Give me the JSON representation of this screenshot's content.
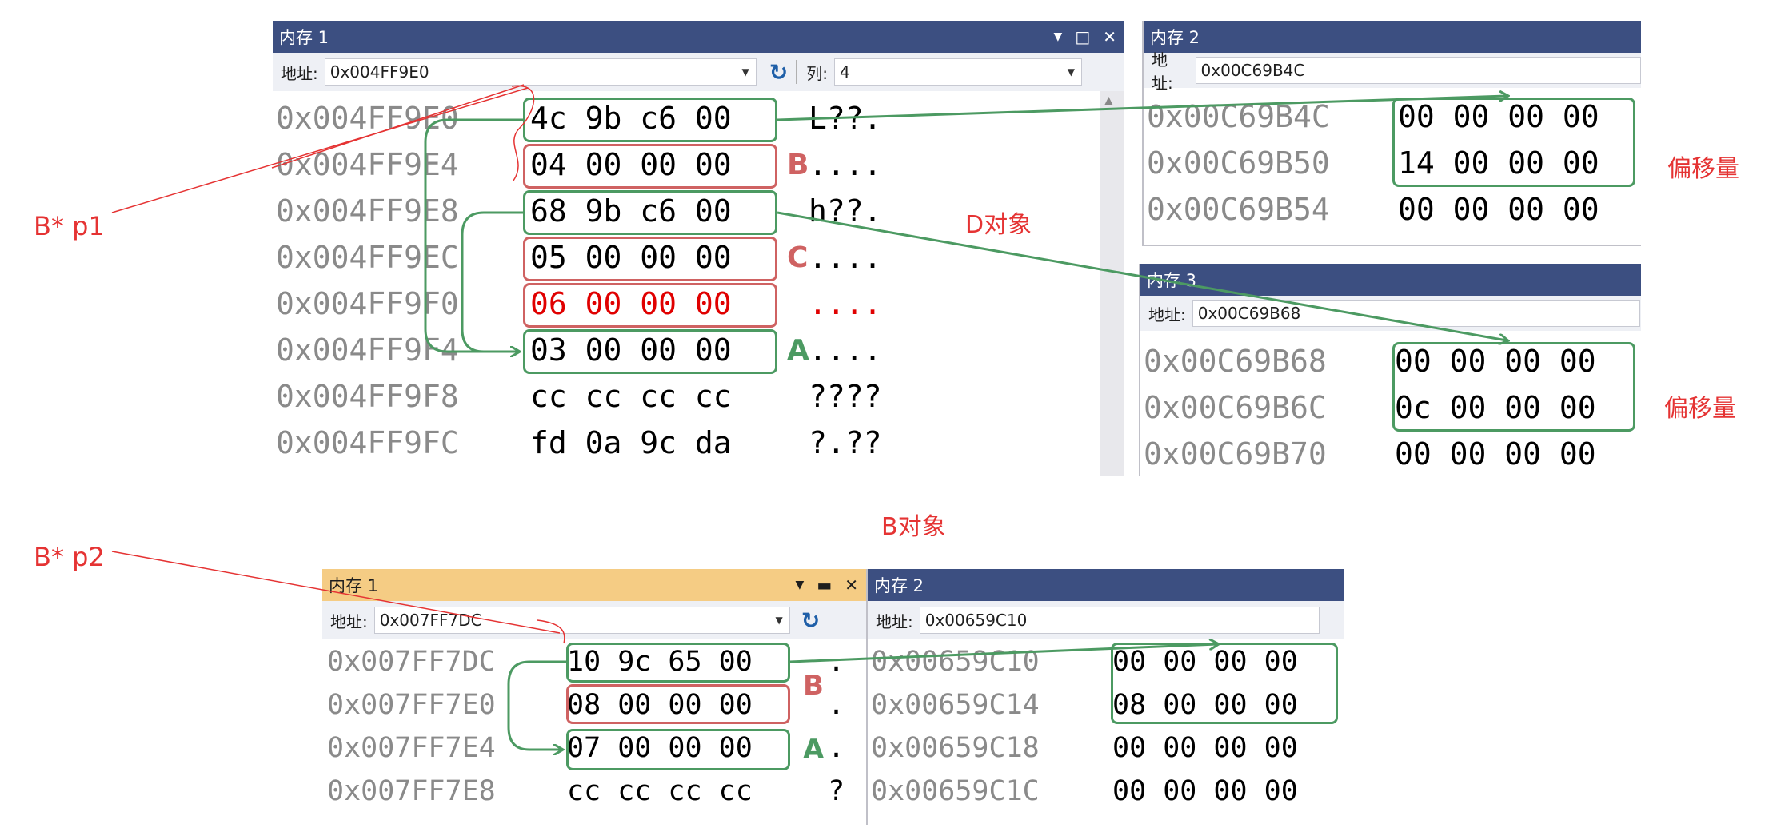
{
  "top": {
    "mem1": {
      "title": "内存 1",
      "addr_label": "地址:",
      "addr_value": "0x004FF9E0",
      "col_label": "列:",
      "col_value": "4",
      "rows": [
        {
          "addr": "0x004FF9E0",
          "bytes": "4c 9b c6 00",
          "ascii": "L??."
        },
        {
          "addr": "0x004FF9E4",
          "bytes": "04 00 00 00",
          "ascii": "...."
        },
        {
          "addr": "0x004FF9E8",
          "bytes": "68 9b c6 00",
          "ascii": "h??."
        },
        {
          "addr": "0x004FF9EC",
          "bytes": "05 00 00 00",
          "ascii": "...."
        },
        {
          "addr": "0x004FF9F0",
          "bytes": "06 00 00 00",
          "ascii": "...."
        },
        {
          "addr": "0x004FF9F4",
          "bytes": "03 00 00 00",
          "ascii": "...."
        },
        {
          "addr": "0x004FF9F8",
          "bytes": "cc cc cc cc",
          "ascii": "????"
        },
        {
          "addr": "0x004FF9FC",
          "bytes": "fd 0a 9c da",
          "ascii": "?.??"
        }
      ]
    },
    "mem2": {
      "title": "内存 2",
      "addr_label": "地址:",
      "addr_value": "0x00C69B4C",
      "rows": [
        {
          "addr": "0x00C69B4C",
          "bytes": "00 00 00 00"
        },
        {
          "addr": "0x00C69B50",
          "bytes": "14 00 00 00"
        },
        {
          "addr": "0x00C69B54",
          "bytes": "00 00 00 00"
        }
      ]
    },
    "mem3": {
      "title": "内存 3",
      "addr_label": "地址:",
      "addr_value": "0x00C69B68",
      "rows": [
        {
          "addr": "0x00C69B68",
          "bytes": "00 00 00 00"
        },
        {
          "addr": "0x00C69B6C",
          "bytes": "0c 00 00 00"
        },
        {
          "addr": "0x00C69B70",
          "bytes": "00 00 00 00"
        }
      ]
    }
  },
  "bottom": {
    "mem1": {
      "title": "内存 1",
      "addr_label": "地址:",
      "addr_value": "0x007FF7DC",
      "rows": [
        {
          "addr": "0x007FF7DC",
          "bytes": "10 9c 65 00",
          "ascii": "."
        },
        {
          "addr": "0x007FF7E0",
          "bytes": "08 00 00 00",
          "ascii": "."
        },
        {
          "addr": "0x007FF7E4",
          "bytes": "07 00 00 00",
          "ascii": "."
        },
        {
          "addr": "0x007FF7E8",
          "bytes": "cc cc cc cc",
          "ascii": "?"
        }
      ]
    },
    "mem2": {
      "title": "内存 2",
      "addr_label": "地址:",
      "addr_value": "0x00659C10",
      "rows": [
        {
          "addr": "0x00659C10",
          "bytes": "00 00 00 00"
        },
        {
          "addr": "0x00659C14",
          "bytes": "08 00 00 00"
        },
        {
          "addr": "0x00659C18",
          "bytes": "00 00 00 00"
        },
        {
          "addr": "0x00659C1C",
          "bytes": "00 00 00 00"
        }
      ]
    }
  },
  "annotations": {
    "p1": "B* p1",
    "p2": "B* p2",
    "d_object": "D对象",
    "b_object": "B对象",
    "offset1": "偏移量",
    "offset2": "偏移量",
    "label_b_top": "B",
    "label_c_top": "C",
    "label_a_top": "A",
    "label_b_bottom": "B",
    "label_a_bottom": "A"
  },
  "colors": {
    "titlebar": "#3c4f81",
    "titlebar_active": "#f5cc84",
    "green_annotation": "#4c9a62",
    "red_annotation": "#cf6262",
    "red_text": "#e53333"
  },
  "icons": {
    "refresh": "refresh-icon",
    "dropdown": "chevron-down-icon",
    "maximize": "maximize-icon",
    "close": "close-icon",
    "pin": "pin-dropdown-icon"
  }
}
